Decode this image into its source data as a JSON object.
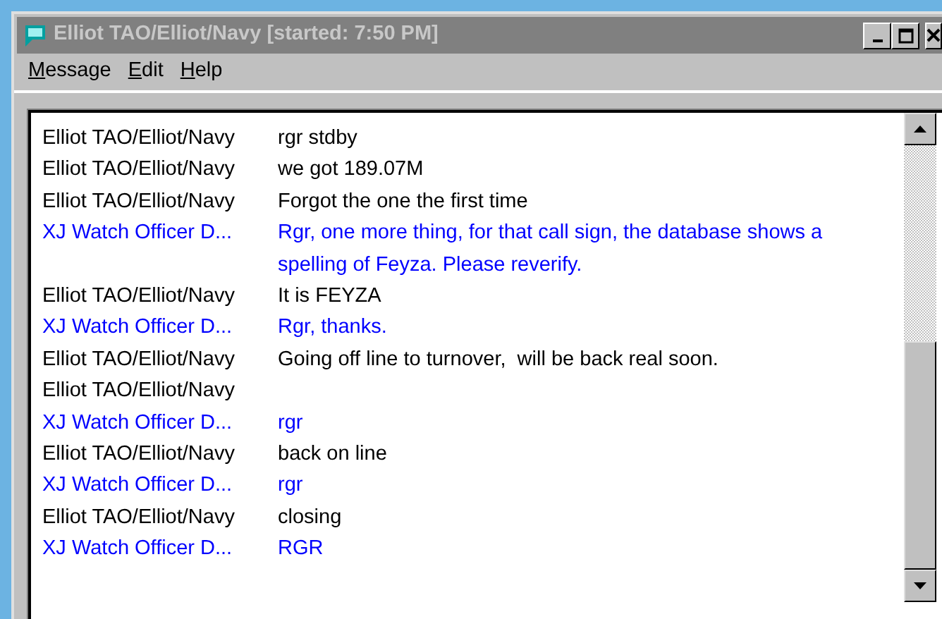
{
  "window": {
    "title": "Elliot TAO/Elliot/Navy [started: 7:50 PM]"
  },
  "menu": [
    "Message",
    "Edit",
    "Help"
  ],
  "messages": [
    {
      "sender": "Elliot TAO/Elliot/Navy",
      "text": "rgr stdby",
      "color": "#000000"
    },
    {
      "sender": "Elliot TAO/Elliot/Navy",
      "text": "we got 189.07M",
      "color": "#000000"
    },
    {
      "sender": "Elliot TAO/Elliot/Navy",
      "text": "Forgot the one the first time",
      "color": "#000000"
    },
    {
      "sender": "XJ Watch Officer D...",
      "text": "Rgr, one more thing, for that call sign, the database shows a spelling of Feyza. Please reverify.",
      "color": "#0000ff"
    },
    {
      "sender": "Elliot TAO/Elliot/Navy",
      "text": "It is FEYZA",
      "color": "#000000"
    },
    {
      "sender": "XJ Watch Officer D...",
      "text": "Rgr, thanks.",
      "color": "#0000ff"
    },
    {
      "sender": "Elliot TAO/Elliot/Navy",
      "text": "Going off line to turnover,  will be back real soon.",
      "color": "#000000"
    },
    {
      "sender": "Elliot TAO/Elliot/Navy",
      "color": "#000000"
    },
    {
      "sender": "XJ Watch Officer D...",
      "text": "rgr",
      "color": "#0000ff"
    },
    {
      "sender": "Elliot TAO/Elliot/Navy",
      "text": "back on line",
      "color": "#000000"
    },
    {
      "sender": "XJ Watch Officer D...",
      "text": "rgr",
      "color": "#0000ff"
    },
    {
      "sender": "Elliot TAO/Elliot/Navy",
      "text": "closing",
      "color": "#000000"
    },
    {
      "sender": "XJ Watch Officer D...",
      "text": "RGR",
      "color": "#0000ff"
    }
  ]
}
